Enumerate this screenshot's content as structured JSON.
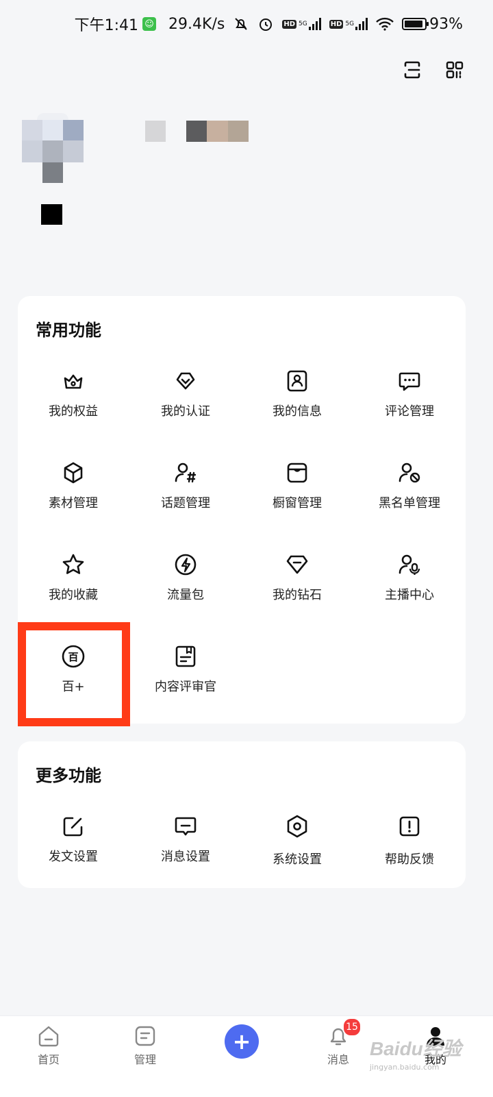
{
  "status_bar": {
    "time": "下午1:41",
    "net_speed": "29.4K/s",
    "hd1": "HD",
    "net1": "5G",
    "hd2": "HD",
    "net2": "5G",
    "battery_percent": "93%",
    "battery_level": 0.93
  },
  "header": {
    "icons": [
      "scan-icon",
      "qr-code-icon"
    ]
  },
  "profile": {
    "avatar": "blurred-avatar"
  },
  "common_functions": {
    "title": "常用功能",
    "items": [
      {
        "label": "我的权益",
        "icon": "crown-icon"
      },
      {
        "label": "我的认证",
        "icon": "verified-badge-icon"
      },
      {
        "label": "我的信息",
        "icon": "id-card-icon"
      },
      {
        "label": "评论管理",
        "icon": "comment-icon"
      },
      {
        "label": "素材管理",
        "icon": "cube-icon"
      },
      {
        "label": "话题管理",
        "icon": "user-hashtag-icon"
      },
      {
        "label": "橱窗管理",
        "icon": "store-icon"
      },
      {
        "label": "黑名单管理",
        "icon": "user-block-icon"
      },
      {
        "label": "我的收藏",
        "icon": "star-icon"
      },
      {
        "label": "流量包",
        "icon": "lightning-icon"
      },
      {
        "label": "我的钻石",
        "icon": "diamond-icon"
      },
      {
        "label": "主播中心",
        "icon": "user-mic-icon"
      },
      {
        "label": "百+",
        "icon": "bai-plus-icon",
        "icon_text": "百"
      },
      {
        "label": "内容评审官",
        "icon": "review-doc-icon"
      }
    ]
  },
  "more_functions": {
    "title": "更多功能",
    "items": [
      {
        "label": "发文设置",
        "icon": "edit-icon"
      },
      {
        "label": "消息设置",
        "icon": "message-icon"
      },
      {
        "label": "系统设置",
        "icon": "settings-hexagon-icon"
      },
      {
        "label": "帮助反馈",
        "icon": "help-feedback-icon"
      }
    ]
  },
  "tab_bar": {
    "tabs": [
      {
        "label": "首页",
        "icon": "home-icon"
      },
      {
        "label": "管理",
        "icon": "manage-icon"
      },
      {
        "label": "",
        "icon": "plus-icon"
      },
      {
        "label": "消息",
        "icon": "bell-icon",
        "badge": "15"
      },
      {
        "label": "我的",
        "icon": "user-icon"
      }
    ],
    "plus_symbol": "+"
  },
  "watermark": {
    "text": "Baidu经验",
    "sub": "jingyan.baidu.com"
  },
  "colors": {
    "background": "#f5f6f8",
    "card": "#ffffff",
    "highlight": "#ff3b17",
    "accent": "#4e6bf0",
    "badge": "#f43c3c"
  }
}
